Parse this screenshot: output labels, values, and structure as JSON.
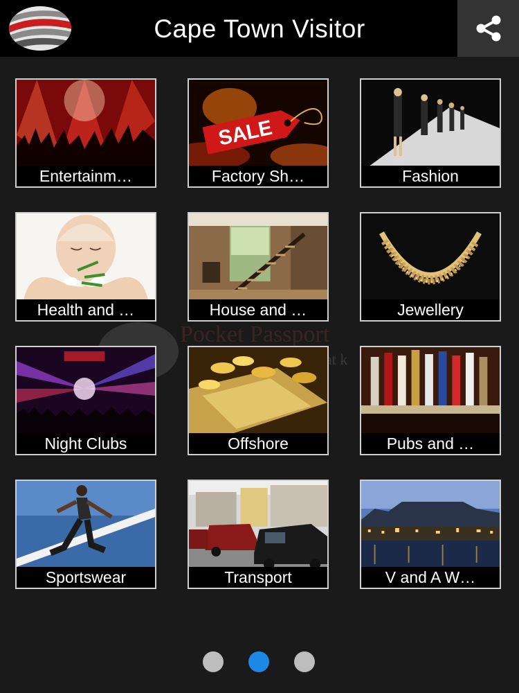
{
  "app": {
    "title": "Cape Town Visitor"
  },
  "header": {
    "share_icon": "share-icon",
    "logo_icon": "globe-logo-icon"
  },
  "watermark": {
    "text": "Pocket Passport",
    "sub": "at k"
  },
  "categories": [
    {
      "label": "Entertainm…",
      "icon": "concert-icon"
    },
    {
      "label": "Factory Sh…",
      "icon": "sale-tag-icon",
      "tag_text": "SALE"
    },
    {
      "label": "Fashion",
      "icon": "runway-icon"
    },
    {
      "label": "Health and …",
      "icon": "spa-icon"
    },
    {
      "label": "House and …",
      "icon": "interior-icon"
    },
    {
      "label": "Jewellery",
      "icon": "necklace-icon"
    },
    {
      "label": "Night Clubs",
      "icon": "club-lights-icon"
    },
    {
      "label": "Offshore",
      "icon": "gold-coins-icon"
    },
    {
      "label": "Pubs and …",
      "icon": "beer-taps-icon"
    },
    {
      "label": "Sportswear",
      "icon": "runner-icon"
    },
    {
      "label": "Transport",
      "icon": "taxi-icon"
    },
    {
      "label": "V and A W…",
      "icon": "waterfront-icon"
    }
  ],
  "pager": {
    "pages": 3,
    "current": 2
  },
  "colors": {
    "accent": "#1e88e5",
    "dot_inactive": "#bdbdbd",
    "header_bg": "#000000",
    "share_bg": "#333333"
  }
}
